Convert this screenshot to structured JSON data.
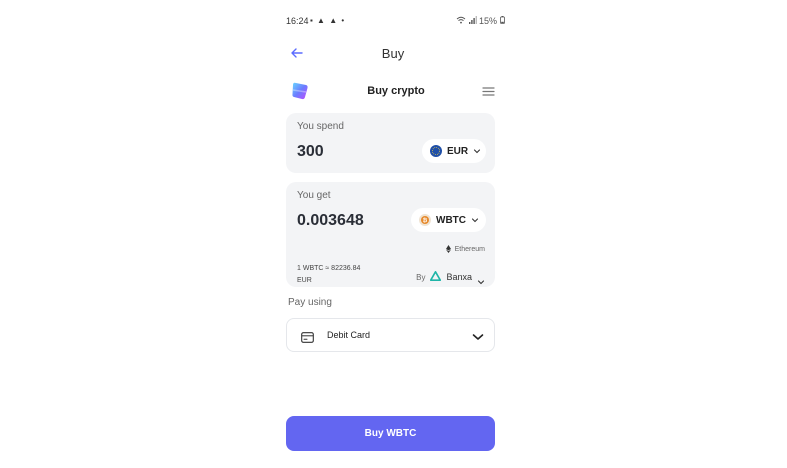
{
  "status_bar": {
    "time": "16:24",
    "indicators": "▪ ▲ ▲ •",
    "battery": "15%"
  },
  "header": {
    "title": "Buy",
    "back_icon": "back-arrow-icon"
  },
  "widget": {
    "title": "Buy crypto",
    "menu_icon": "hamburger-menu-icon"
  },
  "spend": {
    "label": "You spend",
    "amount": "300",
    "currency": "EUR"
  },
  "get": {
    "label": "You get",
    "amount": "0.003648",
    "currency": "WBTC",
    "network": "Ethereum",
    "rate_line1": "1 WBTC ≈ 82236.84",
    "rate_line2": "EUR",
    "provider_by": "By",
    "provider": "Banxa"
  },
  "payment": {
    "label": "Pay using",
    "method": "Debit Card"
  },
  "action": {
    "buy_label": "Buy WBTC"
  },
  "colors": {
    "accent": "#6366f1",
    "card_bg": "#f3f4f6",
    "banxa": "#1fb5a8",
    "eur_blue": "#1f4fa8",
    "btc_orange": "#e6892b"
  }
}
